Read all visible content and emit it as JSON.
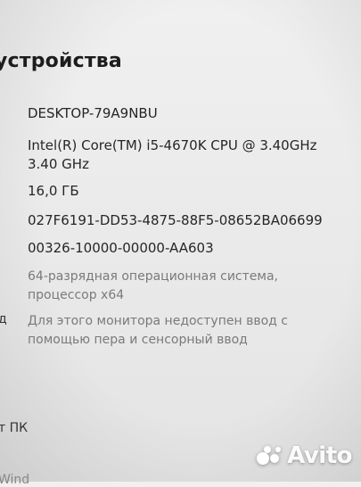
{
  "header": {
    "title": "устройства"
  },
  "specs": {
    "device_name": "DESKTOP-79A9NBU",
    "processor": "Intel(R) Core(TM) i5-4670K CPU @ 3.40GHz 3.40 GHz",
    "ram": "16,0 ГБ",
    "device_id": "027F6191-DD53-4875-88F5-08652BA06699",
    "product_id": "00326-10000-00000-AA603",
    "system_type": "64-разрядная операционная система, процессор x64",
    "pen_touch": "Для этого монитора недоступен ввод с помощью пера и сенсорный ввод"
  },
  "cut_labels": {
    "pen_touch_label_fragment": "д",
    "rename_fragment": "т ПК"
  },
  "footer": {
    "partial_text": "Wind"
  },
  "watermark": {
    "brand": "Avito",
    "icon": "avito-logo-icon"
  }
}
